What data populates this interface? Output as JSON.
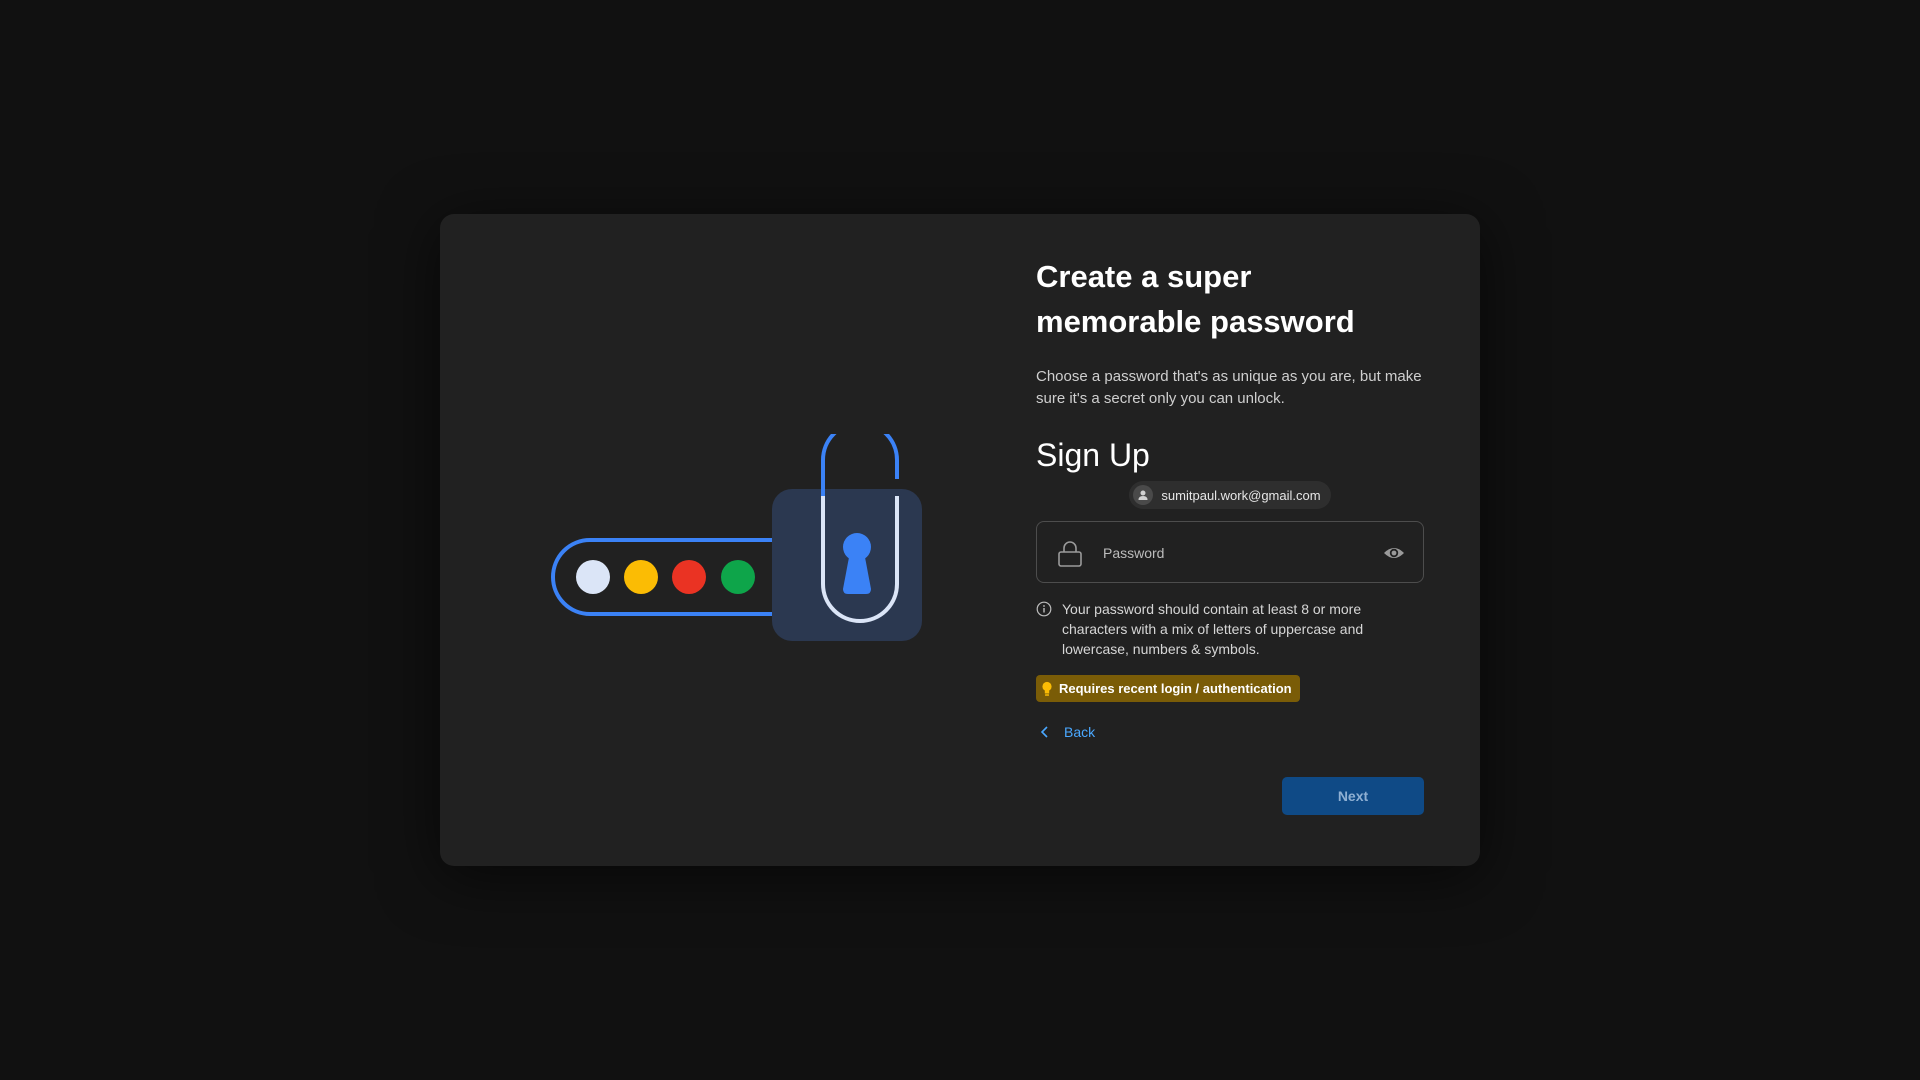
{
  "header": {
    "title": "Create a super memorable password",
    "subtitle": "Choose a password that's as unique as you are, but make sure it's a secret only you can unlock."
  },
  "form": {
    "heading": "Sign Up",
    "email": "sumitpaul.work@gmail.com",
    "password_placeholder": "Password",
    "password_value": "",
    "hint": "Your password should contain at least 8 or more characters with a mix of letters of uppercase and lowercase, numbers & symbols.",
    "badge": "Requires recent login / authentication",
    "back_label": "Back",
    "next_label": "Next"
  },
  "icons": {
    "lock": "lock-icon",
    "eye": "eye-icon",
    "info": "info-icon",
    "bulb": "lightbulb-icon",
    "back": "chevron-left-icon",
    "avatar": "user-icon"
  },
  "colors": {
    "background": "#111111",
    "card": "#212121",
    "accent_blue": "#3b82f6",
    "link": "#4aa8ff",
    "badge_bg": "#7a5c07",
    "next_bg": "#0f4a86",
    "dot_1": "#dbe5f7",
    "dot_2": "#fbbc04",
    "dot_3": "#ea3323",
    "dot_4": "#0ea54a"
  }
}
